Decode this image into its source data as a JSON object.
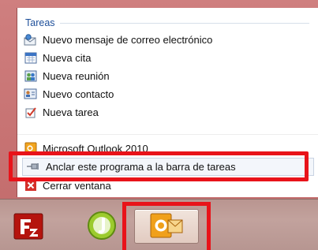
{
  "jumplist": {
    "section_title": "Tareas",
    "tasks": [
      {
        "label": "Nuevo mensaje de correo electrónico",
        "icon": "new-mail-icon"
      },
      {
        "label": "Nueva cita",
        "icon": "calendar-icon"
      },
      {
        "label": "Nueva reunión",
        "icon": "meeting-icon"
      },
      {
        "label": "Nuevo contacto",
        "icon": "contact-card-icon"
      },
      {
        "label": "Nueva tarea",
        "icon": "task-icon"
      }
    ],
    "app_item": {
      "label": "Microsoft Outlook 2010",
      "icon": "outlook-icon"
    },
    "pin_item": {
      "label": "Anclar este programa a la barra de tareas",
      "icon": "pin-icon"
    },
    "close_item": {
      "label": "Cerrar ventana",
      "icon": "close-icon"
    }
  },
  "taskbar": {
    "items": [
      {
        "name": "FileZilla",
        "icon": "filezilla-icon"
      },
      {
        "name": "JDownloader",
        "icon": "jdownloader-icon"
      },
      {
        "name": "Outlook",
        "icon": "outlook-icon",
        "active": true
      }
    ]
  },
  "colors": {
    "annotation_red": "#e8131a",
    "section_title": "#1e4f9a",
    "frame": "#c87474"
  }
}
